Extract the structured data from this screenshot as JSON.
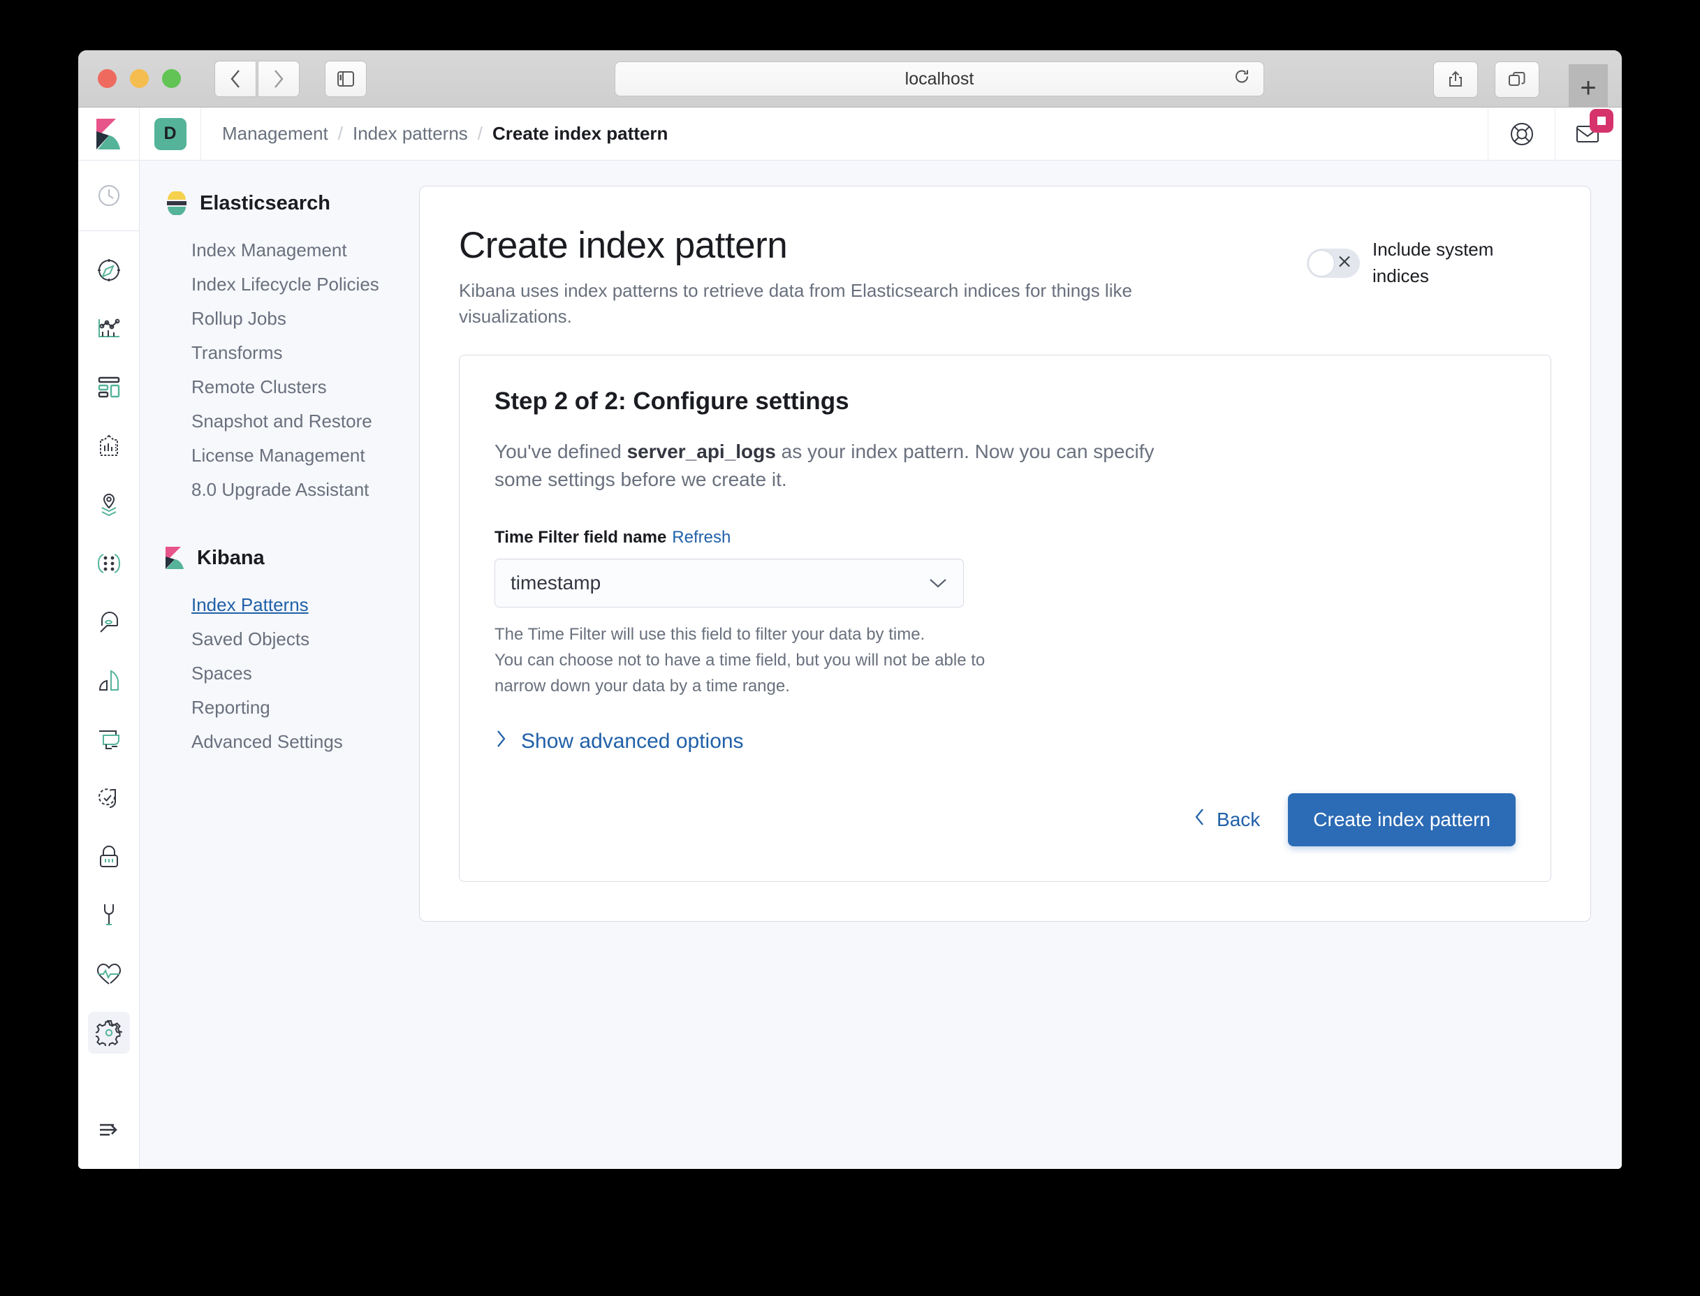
{
  "browser": {
    "url": "localhost",
    "back_icon": "chevron-left-icon",
    "forward_icon": "chevron-right-icon",
    "sidebar_icon": "sidebar-toggle-icon",
    "reload_icon": "reload-icon",
    "share_icon": "share-icon",
    "tabs_icon": "tab-overview-icon",
    "newtab_label": "+"
  },
  "header": {
    "logo": "kibana-logo",
    "space_initial": "D",
    "breadcrumbs": [
      {
        "label": "Management",
        "active": false
      },
      {
        "label": "Index patterns",
        "active": false
      },
      {
        "label": "Create index pattern",
        "active": true
      }
    ],
    "separator": "/",
    "help_icon": "help-lifering-icon",
    "news_icon": "mail-icon"
  },
  "rail": {
    "items": [
      {
        "name": "recently-viewed",
        "icon": "clock-icon"
      },
      {
        "name": "discover",
        "icon": "compass-icon"
      },
      {
        "name": "visualize",
        "icon": "chart-icon"
      },
      {
        "name": "dashboard",
        "icon": "dashboard-icon"
      },
      {
        "name": "canvas",
        "icon": "canvas-icon"
      },
      {
        "name": "maps",
        "icon": "map-layers-icon"
      },
      {
        "name": "machine-learning",
        "icon": "machine-learning-icon"
      },
      {
        "name": "infrastructure",
        "icon": "user-eye-icon"
      },
      {
        "name": "logs",
        "icon": "apm-icon"
      },
      {
        "name": "apm",
        "icon": "monitor-icon"
      },
      {
        "name": "uptime",
        "icon": "uptime-check-icon"
      },
      {
        "name": "siem",
        "icon": "lock-icon"
      },
      {
        "name": "dev-tools",
        "icon": "wrench-icon"
      },
      {
        "name": "monitoring",
        "icon": "heart-pulse-icon"
      },
      {
        "name": "management",
        "icon": "gear-icon",
        "active": true
      }
    ],
    "collapse_icon": "dock-navigation-icon"
  },
  "subnav": {
    "groups": [
      {
        "title": "Elasticsearch",
        "logo": "elasticsearch-logo",
        "links": [
          {
            "label": "Index Management",
            "active": false
          },
          {
            "label": "Index Lifecycle Policies",
            "active": false
          },
          {
            "label": "Rollup Jobs",
            "active": false
          },
          {
            "label": "Transforms",
            "active": false
          },
          {
            "label": "Remote Clusters",
            "active": false
          },
          {
            "label": "Snapshot and Restore",
            "active": false
          },
          {
            "label": "License Management",
            "active": false
          },
          {
            "label": "8.0 Upgrade Assistant",
            "active": false
          }
        ]
      },
      {
        "title": "Kibana",
        "logo": "kibana-logo",
        "links": [
          {
            "label": "Index Patterns",
            "active": true
          },
          {
            "label": "Saved Objects",
            "active": false
          },
          {
            "label": "Spaces",
            "active": false
          },
          {
            "label": "Reporting",
            "active": false
          },
          {
            "label": "Advanced Settings",
            "active": false
          }
        ]
      }
    ]
  },
  "main": {
    "title": "Create index pattern",
    "subtitle": "Kibana uses index patterns to retrieve data from Elasticsearch indices for things like visualizations.",
    "system_indices_toggle": {
      "label_line1": "Include system",
      "label_line2": "indices",
      "state": "off",
      "off_icon": "cross-icon"
    },
    "step": {
      "title": "Step 2 of 2: Configure settings",
      "desc_before": "You've defined ",
      "desc_pattern": "server_api_logs",
      "desc_after": " as your index pattern. Now you can specify some settings before we create it.",
      "field_label": "Time Filter field name",
      "refresh_label": "Refresh",
      "select_value": "timestamp",
      "select_chevron": "chevron-down-icon",
      "help_line1": "The Time Filter will use this field to filter your data by time.",
      "help_line2": "You can choose not to have a time field, but you will not be able to",
      "help_line3": "narrow down your data by a time range.",
      "advanced_label": "Show advanced options",
      "advanced_chevron": "chevron-right-icon",
      "back_label": "Back",
      "back_chevron": "chevron-left-icon",
      "create_label": "Create index pattern"
    }
  },
  "colors": {
    "primary": "#2c6bb5",
    "link": "#2060a8",
    "teal": "#54b399",
    "pink": "#d6336c",
    "yellow": "#f5d14e"
  }
}
